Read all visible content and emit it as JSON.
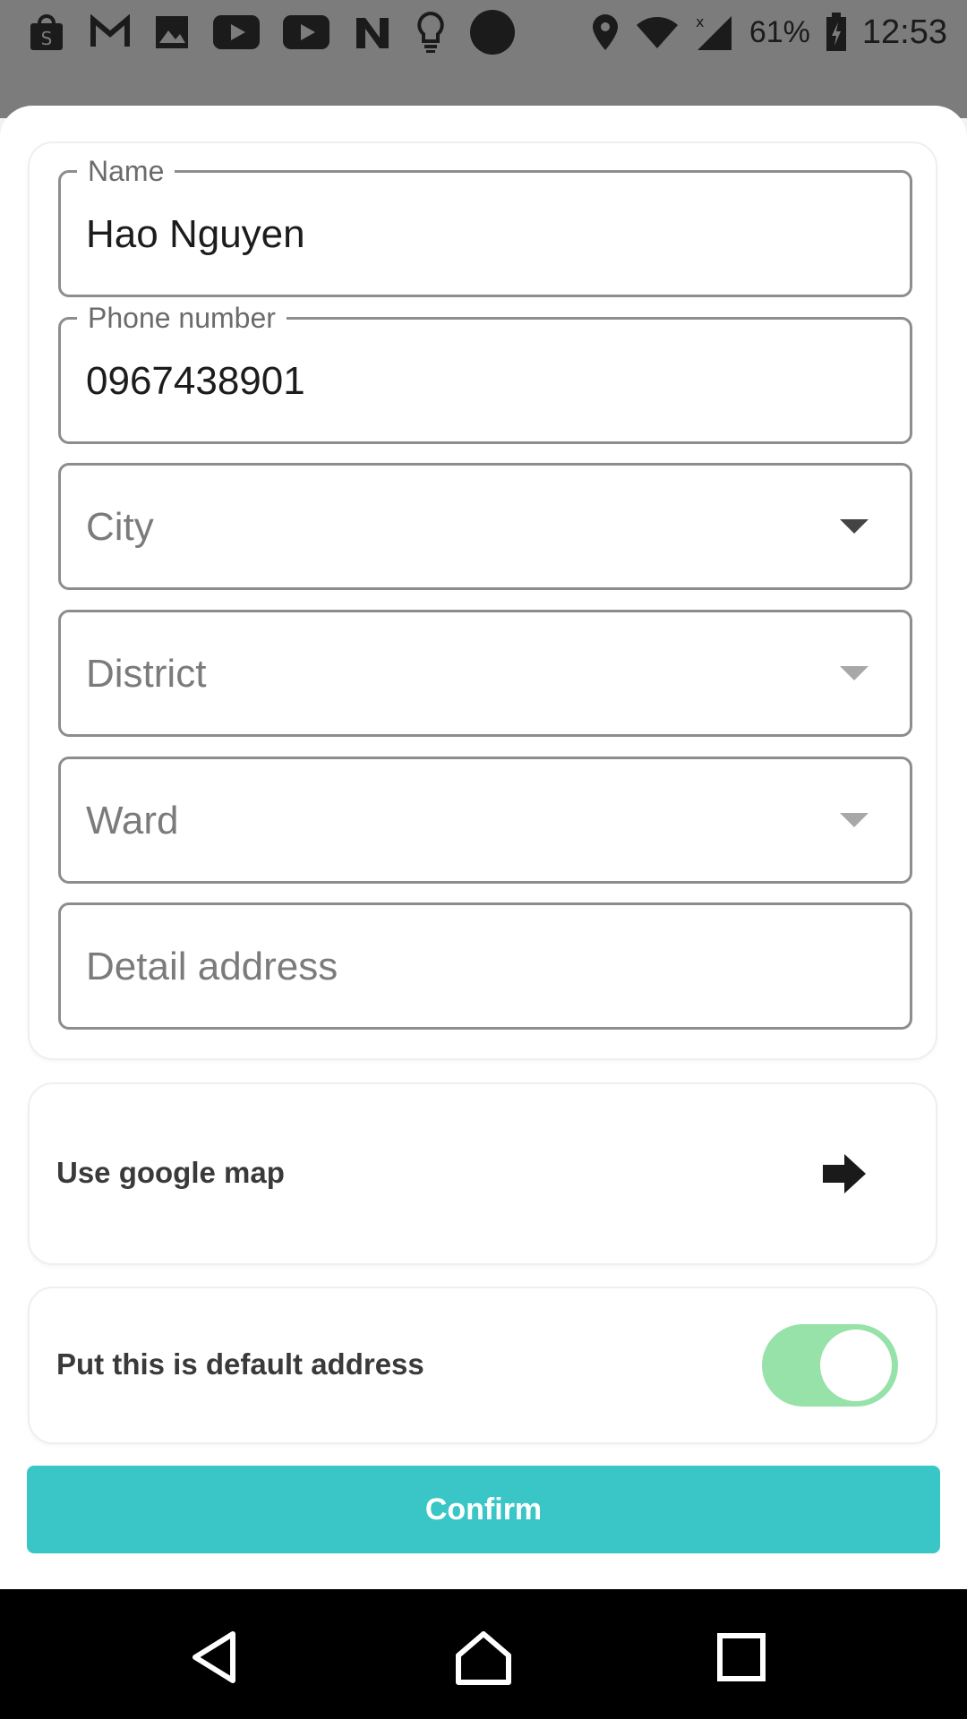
{
  "status_bar": {
    "battery": "61%",
    "time": "12:53",
    "left_icons": [
      "shopping-bag-icon",
      "gmail-icon",
      "image-icon",
      "youtube-icon",
      "youtube-icon",
      "n-app-icon",
      "lightbulb-icon",
      "circle-icon"
    ],
    "right_icons": [
      "location-icon",
      "wifi-icon",
      "signal-icon",
      "battery-charging-icon"
    ]
  },
  "form": {
    "name": {
      "label": "Name",
      "value": "Hao Nguyen"
    },
    "phone": {
      "label": "Phone number",
      "value": "0967438901"
    },
    "city": {
      "placeholder": "City"
    },
    "district": {
      "placeholder": "District"
    },
    "ward": {
      "placeholder": "Ward"
    },
    "detail": {
      "placeholder": "Detail address"
    }
  },
  "map_option": {
    "label": "Use google map",
    "icon": "arrow-right-icon"
  },
  "default_option": {
    "label": "Put this is default address",
    "enabled": true
  },
  "confirm_label": "Confirm",
  "nav": [
    "back-icon",
    "home-icon",
    "recents-icon"
  ],
  "colors": {
    "accent": "#3ac6c7",
    "toggle_on": "#96e2a8",
    "border": "#8d8d8d"
  }
}
